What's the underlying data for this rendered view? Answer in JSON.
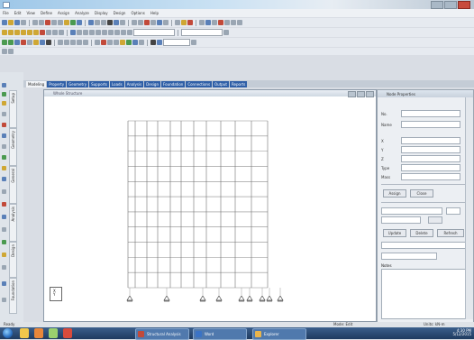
{
  "window": {
    "title": ""
  },
  "menu": [
    "File",
    "Edit",
    "View",
    "Define",
    "Assign",
    "Analyze",
    "Display",
    "Design",
    "Options",
    "Help"
  ],
  "tabs": [
    {
      "label": "Modeling"
    },
    {
      "label": "Property"
    },
    {
      "label": "Geometry"
    },
    {
      "label": "Supports"
    },
    {
      "label": "Loads"
    },
    {
      "label": "Analysis"
    },
    {
      "label": "Design"
    },
    {
      "label": "Foundation"
    },
    {
      "label": "Connections"
    },
    {
      "label": "Output"
    },
    {
      "label": "Reports"
    }
  ],
  "left_tabs": [
    "Setup",
    "Geometry",
    "General",
    "Analysis",
    "Design",
    "Foundation"
  ],
  "view": {
    "title": "Whole Structure",
    "axis": "X\nY"
  },
  "panel": {
    "title": "Node Properties",
    "fields": [
      "No.",
      "Name",
      "X",
      "Y",
      "Z",
      "Type",
      "Mass"
    ],
    "buttons": [
      "Assign",
      "Close"
    ],
    "extra_buttons": [
      "Update",
      "Delete",
      "Refresh"
    ],
    "notes_label": "Notes"
  },
  "status": {
    "left": "Ready",
    "right": "Mode: Edit",
    "far_right": "Units: kN-m"
  },
  "taskbar": {
    "apps": [
      "Structural Analysis",
      "Word",
      "Explorer"
    ],
    "clock": "4:30 PM\n5/12/2015"
  },
  "colors": {
    "tab_blue": "#2f5fa7",
    "grid": "#7f7f7f",
    "taskbar": "#1f3b60"
  },
  "chart_data": {
    "type": "frame",
    "columns_x": [
      0,
      1,
      2,
      3,
      4,
      5,
      6,
      7,
      8,
      9,
      10,
      11
    ],
    "floors": 11,
    "supports": 9
  }
}
